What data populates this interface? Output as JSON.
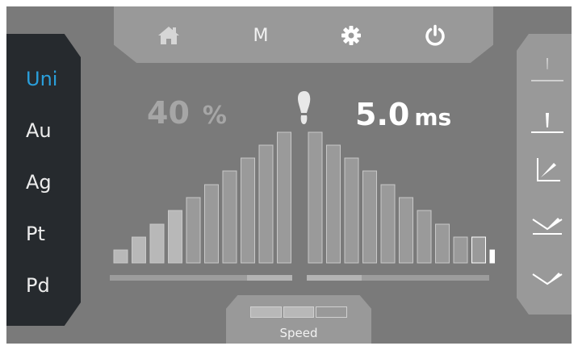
{
  "top_bar": {
    "home_icon": "home-icon",
    "mode_label": "M",
    "settings_icon": "gear-icon",
    "power_icon": "power-icon"
  },
  "metals": [
    {
      "label": "Uni",
      "active": true
    },
    {
      "label": "Au",
      "active": false
    },
    {
      "label": "Ag",
      "active": false
    },
    {
      "label": "Pt",
      "active": false
    },
    {
      "label": "Pd",
      "active": false
    }
  ],
  "power": {
    "value": "40",
    "unit": "%"
  },
  "pulse": {
    "value": "5.0",
    "unit": "ms"
  },
  "footswitch_icon": "footprint-icon",
  "power_levels": {
    "count": 10,
    "selected": 10
  },
  "pulse_levels": {
    "count": 11,
    "selected": 11
  },
  "power_slider": {
    "fraction": 0.75
  },
  "pulse_slider": {
    "fraction": 0.3
  },
  "speed": {
    "label": "Speed",
    "segments": 3,
    "level": 3
  },
  "weld_modes": [
    "spot-weld-thin-icon",
    "spot-weld-icon",
    "angle-weld-icon",
    "v-weld-left-icon",
    "v-weld-right-icon"
  ],
  "colors": {
    "background": "#7a7a7a",
    "panel": "#999999",
    "dark_panel": "#262a2e",
    "accent": "#2a9fdb",
    "bar_light": "#b8b8b8",
    "bar_dim": "#9a9a9a",
    "bar_selected": "#ffffff"
  }
}
